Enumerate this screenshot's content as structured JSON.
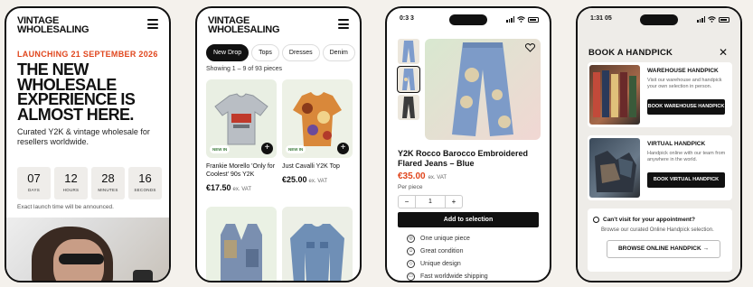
{
  "brand": {
    "logo_line1": "VINTAGE",
    "logo_line2": "WHOLESALING"
  },
  "landing": {
    "launch": "LAUNCHING 21 SEPTEMBER 2026",
    "headline": "THE NEW WHOLESALE EXPERIENCE IS ALMOST HERE.",
    "subtitle": "Curated Y2K & vintage wholesale for resellers worldwide.",
    "countdown": [
      {
        "value": "07",
        "label": "DAYS"
      },
      {
        "value": "12",
        "label": "HOURS"
      },
      {
        "value": "28",
        "label": "MINUTES"
      },
      {
        "value": "16",
        "label": "SECONDS"
      }
    ],
    "note": "Exact launch time will be announced."
  },
  "listing": {
    "tabs": [
      "New Drop",
      "Tops",
      "Dresses",
      "Denim"
    ],
    "showing": "Showing 1 – 9 of 93 pieces",
    "products": [
      {
        "badge": "NEW IN",
        "name": "Frankie Morello 'Only for Coolest' 90s Y2K",
        "price": "€17.50",
        "vat": "ex. VAT",
        "bg": "#e9efe3"
      },
      {
        "badge": "NEW IN",
        "name": "Just Cavalli Y2K Top",
        "price": "€25.00",
        "vat": "ex. VAT",
        "bg": "#edf1e6"
      },
      {
        "badge": "",
        "name": "",
        "price": "",
        "vat": "",
        "bg": "#eaf1e4"
      },
      {
        "badge": "",
        "name": "",
        "price": "",
        "vat": "",
        "bg": "#ecefe6"
      }
    ]
  },
  "product": {
    "status_time": "0:3 3",
    "title": "Y2K Rocco Barocco Embroidered Flared Jeans – Blue",
    "price": "€35.00",
    "vat": "ex. VAT",
    "per_piece": "Per piece",
    "qty_minus": "−",
    "qty": "1",
    "qty_plus": "+",
    "add_button": "Add to selection",
    "features": [
      {
        "icon": "unique-icon",
        "glyph": "◎",
        "text": "One unique piece"
      },
      {
        "icon": "condition-icon",
        "glyph": "☺",
        "text": "Great condition"
      },
      {
        "icon": "design-icon",
        "glyph": "◇",
        "text": "Unique design"
      },
      {
        "icon": "shipping-icon",
        "glyph": "▭",
        "text": "Fast worldwide shipping"
      }
    ]
  },
  "handpick": {
    "status_time": "1:31 05",
    "title": "BOOK A HANDPICK",
    "options": [
      {
        "title": "WAREHOUSE HANDPICK",
        "desc": "Visit our warehouse and handpick your own selection in person.",
        "button": "BOOK WAREHOUSE HANDPICK"
      },
      {
        "title": "VIRTUAL HANDPICK",
        "desc": "Handpick online with our team from anywhere in the world.",
        "button": "BOOK VIRTUAL HANDPICK"
      }
    ],
    "visit_question": "Can't visit for your appointment?",
    "visit_desc": "Browse our curated Online Handpick selection.",
    "browse_button": "BROWSE ONLINE HANDPICK"
  }
}
